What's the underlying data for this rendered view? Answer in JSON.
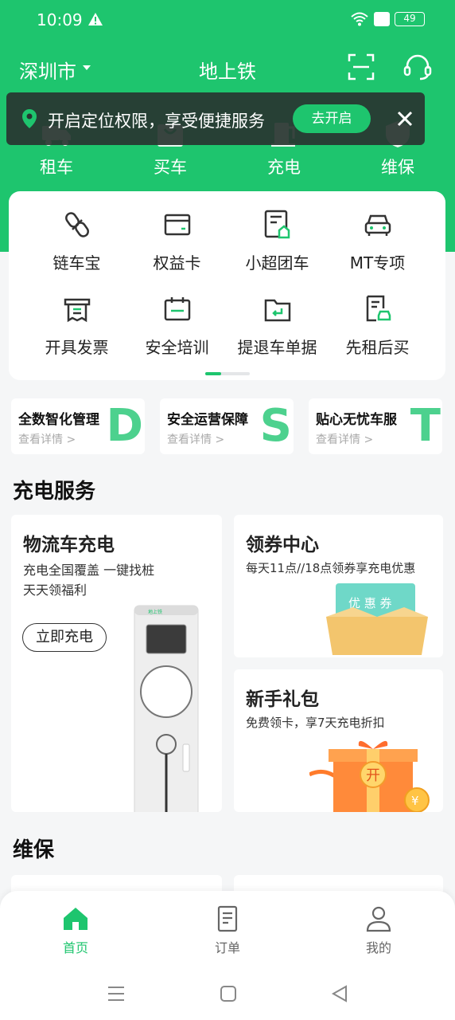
{
  "status_bar": {
    "time": "10:09",
    "battery": "49"
  },
  "topnav": {
    "city": "深圳市",
    "title": "地上铁"
  },
  "categories": [
    {
      "label": "租车",
      "icon": "truck-icon"
    },
    {
      "label": "买车",
      "icon": "bag-icon"
    },
    {
      "label": "充电",
      "icon": "charger-icon"
    },
    {
      "label": "维保",
      "icon": "shield-icon"
    }
  ],
  "location_banner": {
    "text": "开启定位权限，享受便捷服务",
    "button": "去开启"
  },
  "quick_grid": [
    {
      "label": "链车宝",
      "icon": "link-icon"
    },
    {
      "label": "权益卡",
      "icon": "card-icon"
    },
    {
      "label": "小超团车",
      "icon": "group-car-icon"
    },
    {
      "label": "MT专项",
      "icon": "car-front-icon"
    },
    {
      "label": "开具发票",
      "icon": "invoice-icon"
    },
    {
      "label": "安全培训",
      "icon": "training-icon"
    },
    {
      "label": "提退车单据",
      "icon": "return-doc-icon"
    },
    {
      "label": "先租后买",
      "icon": "rent-buy-icon"
    }
  ],
  "promos": [
    {
      "title": "全数智化管理",
      "sub": "查看详情 >",
      "letter": "D"
    },
    {
      "title": "安全运营保障",
      "sub": "查看详情 >",
      "letter": "S"
    },
    {
      "title": "贴心无忧车服",
      "sub": "查看详情 >",
      "letter": "T"
    }
  ],
  "charging": {
    "section_title": "充电服务",
    "logistics": {
      "title": "物流车充电",
      "desc1": "充电全国覆盖 一键找桩",
      "desc2": "天天领福利",
      "button": "立即充电",
      "charger_brand": "地上铁"
    },
    "coupon": {
      "title": "领券中心",
      "desc": "每天11点//18点领券享充电优惠",
      "ticket": "优 惠 券"
    },
    "gift": {
      "title": "新手礼包",
      "desc": "免费领卡，享7天充电折扣",
      "badge": "开",
      "coin": "¥"
    }
  },
  "maintenance": {
    "section_title": "维保"
  },
  "tabbar": [
    {
      "label": "首页",
      "icon": "home-icon",
      "active": true
    },
    {
      "label": "订单",
      "icon": "order-icon",
      "active": false
    },
    {
      "label": "我的",
      "icon": "profile-icon",
      "active": false
    }
  ],
  "colors": {
    "brand": "#1ec56e",
    "banner_bg": "#283430",
    "background": "#f5f6f7"
  }
}
